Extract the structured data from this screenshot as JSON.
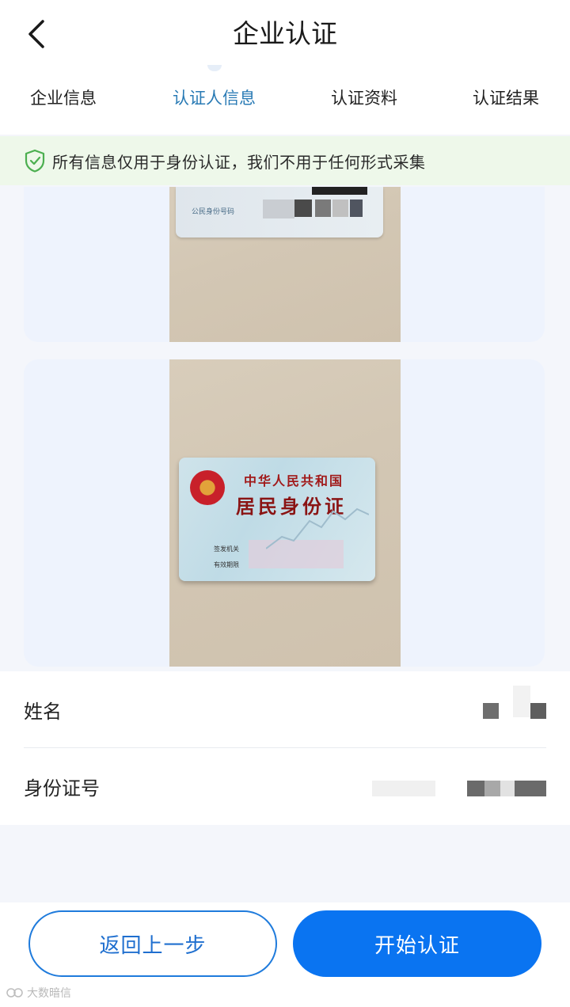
{
  "header": {
    "title": "企业认证",
    "tabs": [
      {
        "label": "企业信息",
        "active": false
      },
      {
        "label": "认证人信息",
        "active": true
      },
      {
        "label": "认证资料",
        "active": false
      },
      {
        "label": "认证结果",
        "active": false
      }
    ]
  },
  "notice": {
    "text": "所有信息仅用于身份认证，我们不用于任何形式采集",
    "icon": "shield-check-icon"
  },
  "id_back_photo": {
    "field_label": "公民身份号码"
  },
  "id_front_photo": {
    "line1": "中华人民共和国",
    "line2": "居民身份证",
    "field_issuer": "签发机关",
    "field_valid": "有效期限"
  },
  "form": {
    "name_label": "姓名",
    "id_number_label": "身份证号"
  },
  "buttons": {
    "back_label": "返回上一步",
    "start_label": "开始认证"
  },
  "watermark": {
    "text": "大数暗信"
  },
  "colors": {
    "accent": "#0a74f1",
    "active_tab": "#2a7bb5",
    "notice_bg": "#eef8ea",
    "card_bg": "#eef3fd"
  }
}
